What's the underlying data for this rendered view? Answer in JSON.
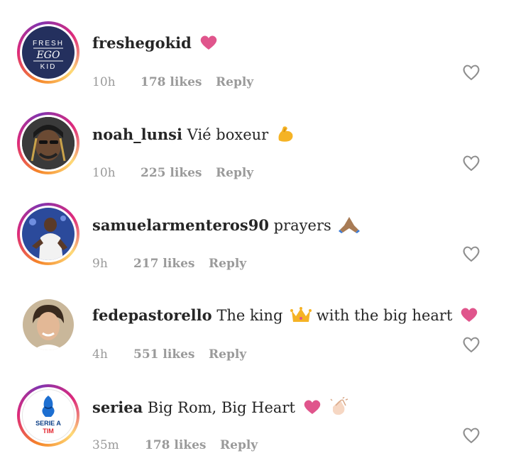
{
  "comments": [
    {
      "username": "freshegokid",
      "text": "",
      "emoji": "heart",
      "time": "10h",
      "likes": "178 likes",
      "reply": "Reply",
      "avatar": {
        "type": "logo",
        "top": "FRESH",
        "mid": "EGO",
        "bottom": "KID"
      }
    },
    {
      "username": "noah_lunsi",
      "text": "Vié boxeur",
      "emoji": "flexed-biceps",
      "time": "10h",
      "likes": "225 likes",
      "reply": "Reply",
      "avatar": {
        "type": "photo"
      }
    },
    {
      "username": "samuelarmenteros90",
      "text": "prayers",
      "emoji": "folded-hands",
      "time": "9h",
      "likes": "217 likes",
      "reply": "Reply",
      "avatar": {
        "type": "photo"
      }
    },
    {
      "username": "fedepastorello",
      "text": "The king",
      "emoji": "crown",
      "text2": "with the big heart",
      "emoji2": "heart",
      "time": "4h",
      "likes": "551 likes",
      "reply": "Reply",
      "avatar": {
        "type": "photo"
      }
    },
    {
      "username": "seriea",
      "text": "Big Rom, Big Heart",
      "emoji": "heart",
      "emoji2": "clapping-hands",
      "time": "35m",
      "likes": "178 likes",
      "reply": "Reply",
      "avatar": {
        "type": "logo",
        "top": "SERIE A",
        "bottom": "TIM"
      }
    }
  ],
  "colors": {
    "heart": "#e0558c",
    "gradient": [
      "#f58529",
      "#dd2a7b",
      "#8134af",
      "#feda77"
    ],
    "meta": "#9a9a9a"
  }
}
